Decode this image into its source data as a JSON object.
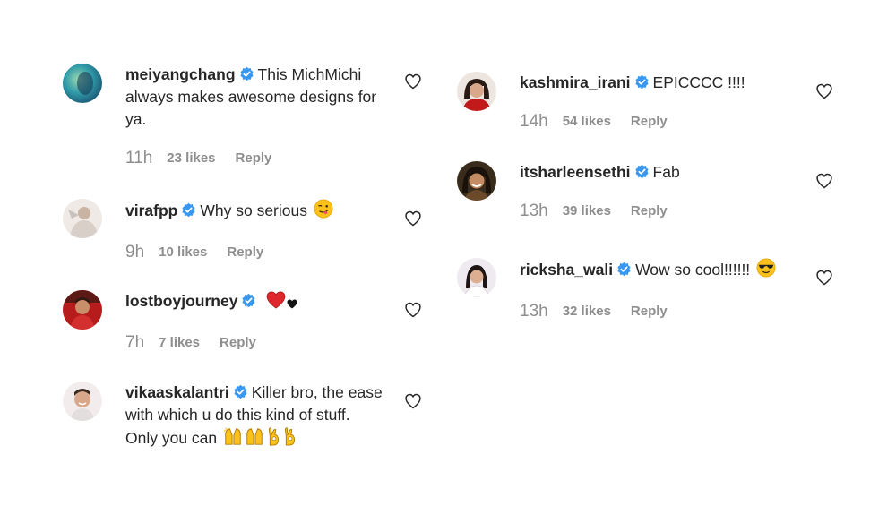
{
  "left_comments": [
    {
      "username": "meiyangchang",
      "text": "This MichMichi always makes awesome designs for ya.",
      "emoji": "",
      "time": "11h",
      "likes": "23 likes",
      "reply": "Reply"
    },
    {
      "username": "virafpp",
      "text": "Why so serious",
      "emoji": "winking-tongue-face",
      "time": "9h",
      "likes": "10 likes",
      "reply": "Reply"
    },
    {
      "username": "lostboyjourney",
      "text": "",
      "emoji": "red-heart black-heart",
      "time": "7h",
      "likes": "7 likes",
      "reply": "Reply"
    },
    {
      "username": "vikaaskalantri",
      "text": "Killer bro, the ease with which u do this kind of stuff. Only you can",
      "emoji": "raising-hands raising-hands ok-hand ok-hand",
      "time": "",
      "likes": "",
      "reply": ""
    }
  ],
  "right_comments": [
    {
      "username": "kashmira_irani",
      "text": "EPICCCC !!!!",
      "emoji": "",
      "time": "14h",
      "likes": "54 likes",
      "reply": "Reply"
    },
    {
      "username": "itsharleensethi",
      "text": "Fab",
      "emoji": "",
      "time": "13h",
      "likes": "39 likes",
      "reply": "Reply"
    },
    {
      "username": "ricksha_wali",
      "text": "Wow so cool!!!!!!",
      "emoji": "sunglasses-face",
      "time": "13h",
      "likes": "32 likes",
      "reply": "Reply"
    }
  ],
  "colors": {
    "verified_badge": "#3897f0",
    "meta_text": "#8e8e8e",
    "text": "#262626",
    "heart_outline": "#262626"
  },
  "icons": {
    "verified": "verified-badge-icon",
    "like": "heart-outline-icon"
  }
}
